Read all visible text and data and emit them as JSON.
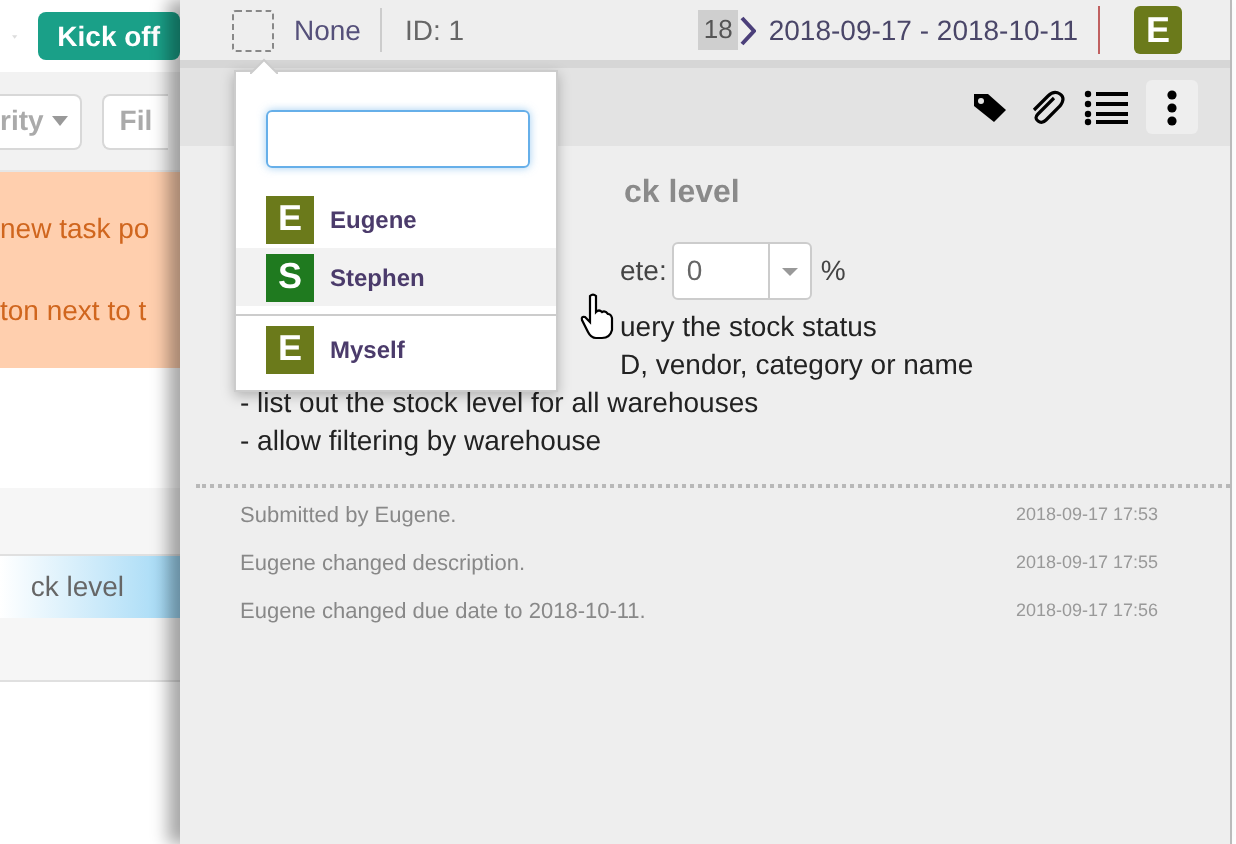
{
  "background": {
    "kick_off_button": "Kick off",
    "filters": [
      {
        "label": "rity",
        "has_caret": true
      },
      {
        "label": "Fil",
        "has_caret": false
      }
    ],
    "notes": [
      "new task po",
      "ton next to t"
    ],
    "list_item": {
      "label": "ck level",
      "selected": true
    }
  },
  "task": {
    "checkbox": {
      "checked": false
    },
    "assignee": "None",
    "id": "ID: 1",
    "sprint": "18",
    "dates": "2018-09-17 - 2018-10-11",
    "owner": {
      "letter": "E",
      "color": "#6b7a1b"
    },
    "title": "ck level",
    "percent_label": "ete:",
    "percent_value": "0",
    "percent_unit": "%",
    "description": [
      {
        "text": "uery the stock status",
        "covered": true
      },
      {
        "text": "D, vendor, category or name",
        "covered": true
      },
      {
        "text": "- list out the stock level for all warehouses",
        "covered": false
      },
      {
        "text": "- allow filtering by warehouse",
        "covered": false
      }
    ],
    "activity": [
      {
        "text": "Submitted by Eugene.",
        "time": "2018-09-17 17:53"
      },
      {
        "text": "Eugene changed description.",
        "time": "2018-09-17 17:55"
      },
      {
        "text": "Eugene changed due date to 2018-10-11.",
        "time": "2018-09-17 17:56"
      }
    ]
  },
  "assignee_menu": {
    "items": [
      {
        "kind": "user",
        "letter": "E",
        "name": "Eugene",
        "color": "#6b7a1b",
        "highlighted": false
      },
      {
        "kind": "user",
        "letter": "S",
        "name": "Stephen",
        "color": "#1f7a1f",
        "highlighted": true
      },
      {
        "kind": "self",
        "letter": "E",
        "name": "Myself",
        "color": "#6b7a1b",
        "highlighted": false
      }
    ]
  }
}
